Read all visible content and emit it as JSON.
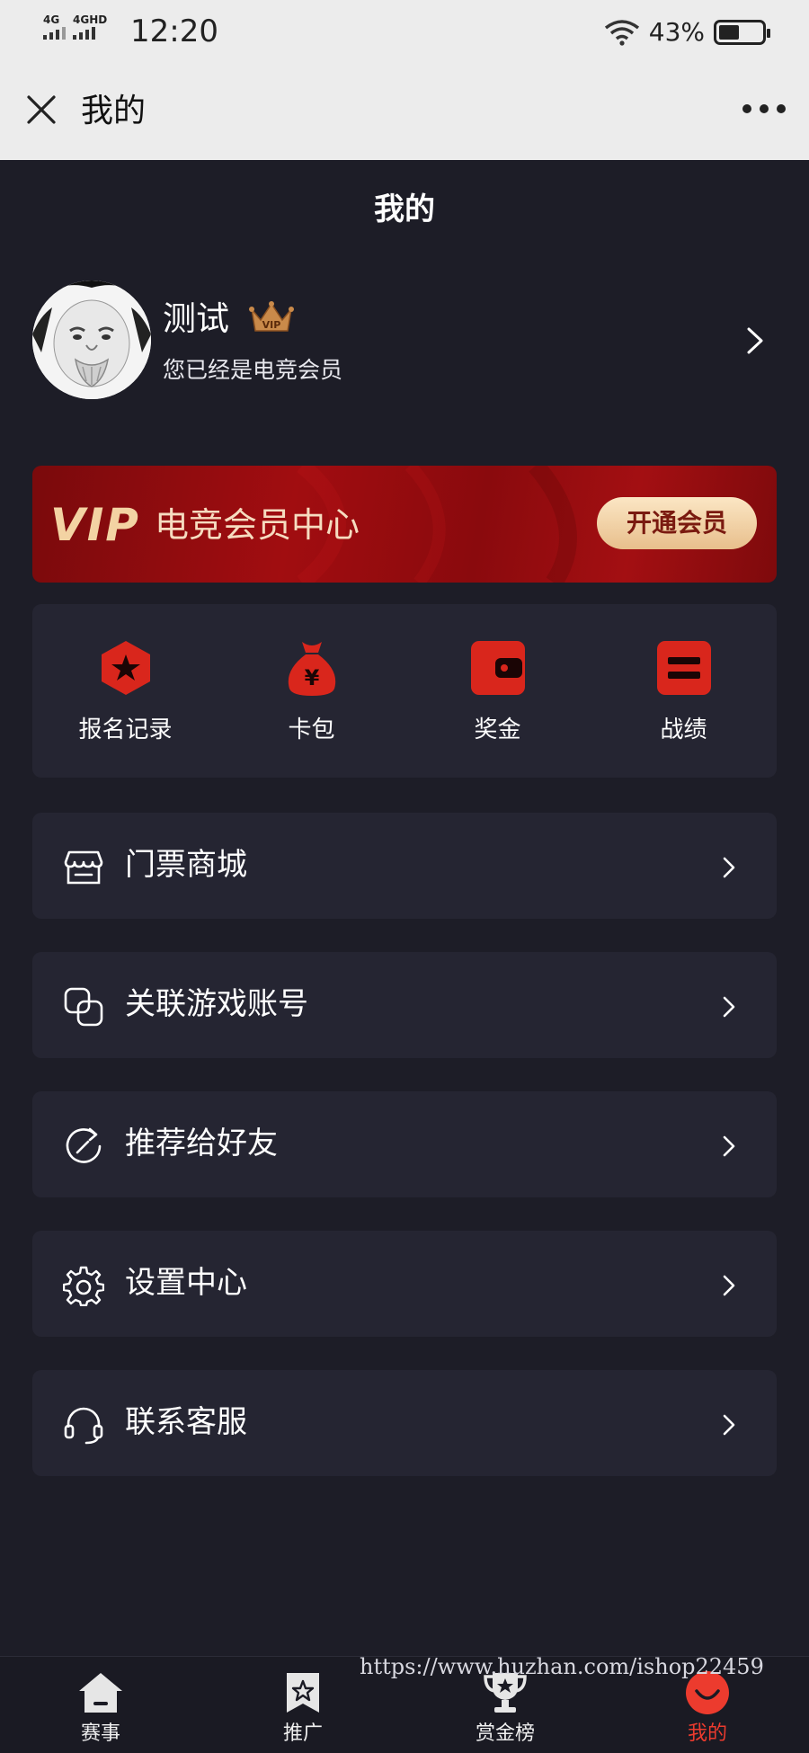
{
  "status_bar": {
    "net1": "4G",
    "net2": "4GHD",
    "time": "12:20",
    "battery": "43%"
  },
  "nav": {
    "title": "我的"
  },
  "page": {
    "title": "我的"
  },
  "profile": {
    "name": "测试",
    "subtitle": "您已经是电竞会员",
    "badge": "VIP"
  },
  "vip_banner": {
    "logo": "VIP",
    "title": "电竞会员中心",
    "button": "开通会员"
  },
  "quick_actions": [
    {
      "label": "报名记录",
      "icon": "hexagon-star-icon"
    },
    {
      "label": "卡包",
      "icon": "money-bag-icon"
    },
    {
      "label": "奖金",
      "icon": "wallet-icon"
    },
    {
      "label": "战绩",
      "icon": "record-icon"
    }
  ],
  "menu": [
    {
      "label": "门票商城",
      "icon": "store-icon"
    },
    {
      "label": "关联游戏账号",
      "icon": "link-icon"
    },
    {
      "label": "推荐给好友",
      "icon": "share-icon"
    },
    {
      "label": "设置中心",
      "icon": "gear-icon"
    },
    {
      "label": "联系客服",
      "icon": "headset-icon"
    }
  ],
  "watermark": "https://www.huzhan.com/ishop22459",
  "tabs": [
    {
      "label": "赛事",
      "icon": "home-icon",
      "active": false
    },
    {
      "label": "推广",
      "icon": "bookmark-star-icon",
      "active": false
    },
    {
      "label": "赏金榜",
      "icon": "trophy-icon",
      "active": false
    },
    {
      "label": "我的",
      "icon": "smile-icon",
      "active": true
    }
  ],
  "colors": {
    "accent": "#ec3b2e",
    "card": "#252532",
    "background": "#1d1d27",
    "vip_red": "#a10d10",
    "vip_gold": "#f3d3a3"
  }
}
